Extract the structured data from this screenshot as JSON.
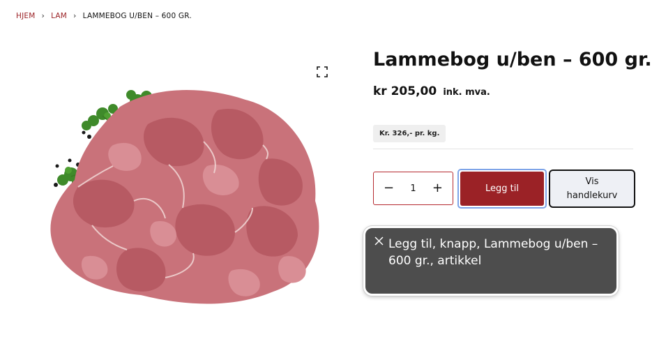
{
  "breadcrumb": {
    "home": "HJEM",
    "category": "LAM",
    "current": "LAMMEBOG U/BEN – 600 GR."
  },
  "product": {
    "title": "Lammebog u/ben – 600 gr.",
    "price": "kr 205,00",
    "vat_note": "ink. mva.",
    "unit_price": "Kr. 326,- pr. kg.",
    "image_icon": "expand-icon"
  },
  "cart": {
    "decrement": "−",
    "quantity": "1",
    "increment": "+",
    "add_label": "Legg til",
    "view_cart_label": "Vis handlekurv"
  },
  "toast": {
    "message": "Legg til, knapp, Lammebog u/ben – 600 gr., artikkel"
  },
  "colors": {
    "accent": "#9b2226",
    "focus_ring": "#7ea4e8",
    "toast_bg": "#4d4d4d"
  }
}
